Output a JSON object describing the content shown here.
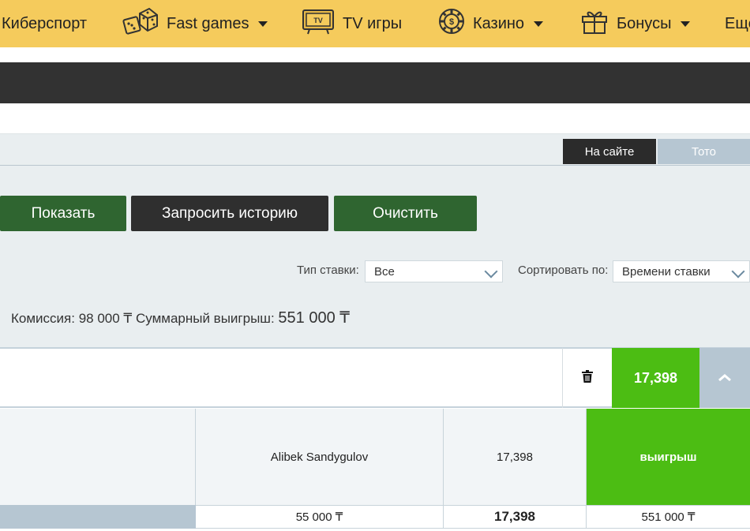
{
  "nav": {
    "items": [
      {
        "label": "Киберспорт",
        "icon": "",
        "caret": false
      },
      {
        "label": "Fast games",
        "icon": "dice-icon",
        "caret": true
      },
      {
        "label": "TV игры",
        "icon": "tv-icon",
        "caret": false
      },
      {
        "label": "Казино",
        "icon": "casino-chip-icon",
        "caret": true
      },
      {
        "label": "Бонусы",
        "icon": "gift-icon",
        "caret": true
      },
      {
        "label": "Ещё",
        "icon": "",
        "caret": false
      }
    ]
  },
  "tabs": {
    "site": "На сайте",
    "toto": "Тото"
  },
  "buttons": {
    "show": "Показать",
    "history": "Запросить историю",
    "clear": "Очистить"
  },
  "filters": {
    "bet_type_label": "Тип ставки:",
    "bet_type_value": "Все",
    "sort_label": "Сортировать по:",
    "sort_value": "Времени ставки"
  },
  "summary": {
    "commission_label": "Комиссия:",
    "commission_value": "98 000 ₸",
    "total_win_label": "Суммарный выигрыш:",
    "total_win_value": "551 000 ₸"
  },
  "bet": {
    "coefficient": "17,398",
    "details": {
      "player": "Alibek Sandygulov",
      "coefficient": "17,398",
      "result": "выигрыш"
    },
    "totals": {
      "stake": "55 000 ₸",
      "coefficient": "17,398",
      "payout": "551 000 ₸"
    }
  },
  "colors": {
    "nav_bg": "#f5cb5c",
    "green": "#2f6530",
    "win_green": "#4cbd13",
    "dark": "#323232"
  }
}
